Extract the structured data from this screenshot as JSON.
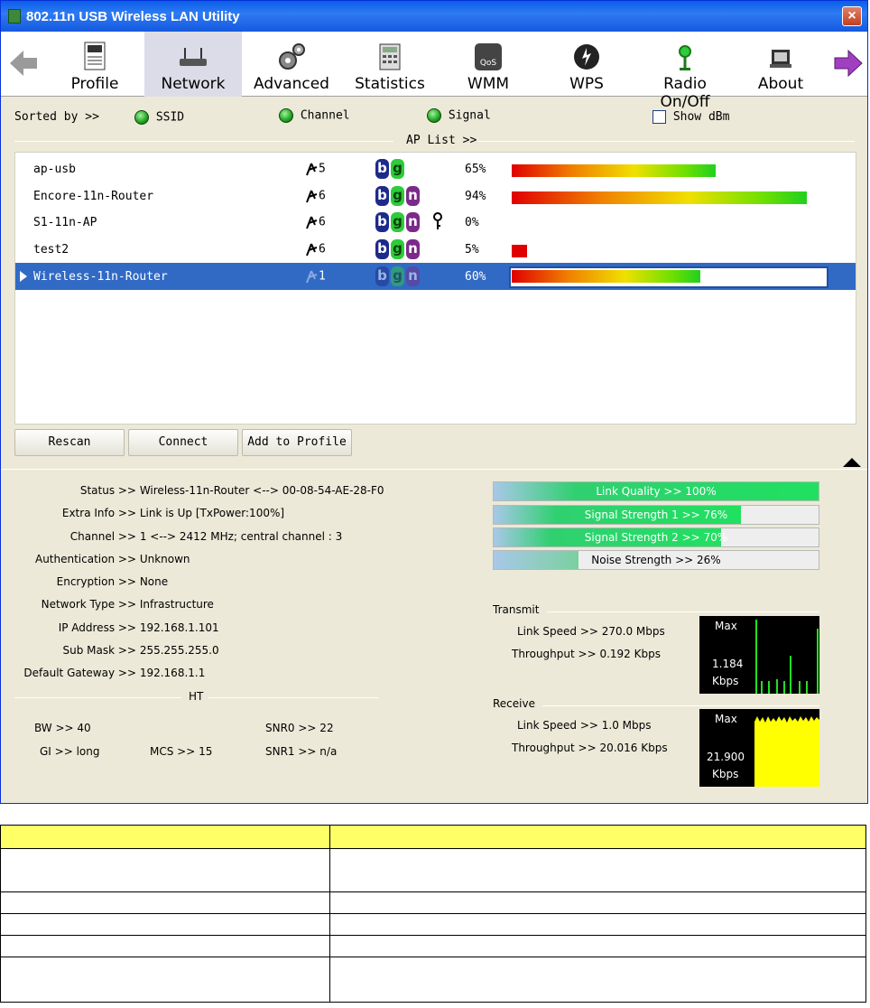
{
  "window": {
    "title": "802.11n USB Wireless LAN Utility",
    "close": "×"
  },
  "toolbar": {
    "items": [
      {
        "label": "Profile",
        "icon": "profile-icon"
      },
      {
        "label": "Network",
        "icon": "router-icon"
      },
      {
        "label": "Advanced",
        "icon": "gears-icon"
      },
      {
        "label": "Statistics",
        "icon": "calculator-icon"
      },
      {
        "label": "WMM",
        "icon": "qos-icon"
      },
      {
        "label": "WPS",
        "icon": "wps-icon"
      },
      {
        "label": "Radio On/Off",
        "icon": "radio-icon"
      },
      {
        "label": "About",
        "icon": "about-icon"
      }
    ]
  },
  "sort": {
    "label": "Sorted by >>",
    "ssid": "SSID",
    "channel": "Channel",
    "signal": "Signal",
    "show_dbm": "Show dBm"
  },
  "ap_list": {
    "title": "AP List >>",
    "rows": [
      {
        "ssid": "ap-usb",
        "channel": "5",
        "modes": [
          "b",
          "g"
        ],
        "signal": "65%",
        "signal_value": 65,
        "locked": false
      },
      {
        "ssid": "Encore-11n-Router",
        "channel": "6",
        "modes": [
          "b",
          "g",
          "n"
        ],
        "signal": "94%",
        "signal_value": 94,
        "locked": false
      },
      {
        "ssid": "S1-11n-AP",
        "channel": "6",
        "modes": [
          "b",
          "g",
          "n"
        ],
        "signal": "0%",
        "signal_value": 0,
        "locked": true
      },
      {
        "ssid": "test2",
        "channel": "6",
        "modes": [
          "b",
          "g",
          "n"
        ],
        "signal": "5%",
        "signal_value": 5,
        "locked": false
      },
      {
        "ssid": "Wireless-11n-Router",
        "channel": "1",
        "modes": [
          "b",
          "g",
          "n"
        ],
        "signal": "60%",
        "signal_value": 60,
        "locked": false,
        "selected": true
      }
    ]
  },
  "buttons": {
    "rescan": "Rescan",
    "connect": "Connect",
    "add_profile": "Add to Profile"
  },
  "status": {
    "status_k": "Status >>",
    "status_v": "Wireless-11n-Router <--> 00-08-54-AE-28-F0",
    "extra_k": "Extra Info >>",
    "extra_v": "Link is Up [TxPower:100%]",
    "channel_k": "Channel >>",
    "channel_v": "1 <--> 2412 MHz; central channel : 3",
    "auth_k": "Authentication >>",
    "auth_v": "Unknown",
    "enc_k": "Encryption >>",
    "enc_v": "None",
    "nettype_k": "Network Type >>",
    "nettype_v": "Infrastructure",
    "ip_k": "IP Address >>",
    "ip_v": "192.168.1.101",
    "mask_k": "Sub Mask >>",
    "mask_v": "255.255.255.0",
    "gw_k": "Default Gateway >>",
    "gw_v": "192.168.1.1"
  },
  "ht": {
    "title": "HT",
    "bw": "BW >> 40",
    "gi": "GI >> long",
    "mcs": "MCS >> 15",
    "snr0": "SNR0 >> 22",
    "snr1": "SNR1 >> n/a"
  },
  "meters": [
    {
      "label": "Link Quality >> 100%",
      "value": 100
    },
    {
      "label": "Signal Strength 1 >> 76%",
      "value": 76
    },
    {
      "label": "Signal Strength 2 >> 70%",
      "value": 70
    },
    {
      "label": "Noise Strength >> 26%",
      "value": 26
    }
  ],
  "transmit": {
    "title": "Transmit",
    "link_speed": "Link Speed >> 270.0 Mbps",
    "throughput": "Throughput >> 0.192 Kbps",
    "graph_max": "Max",
    "graph_value": "1.184",
    "graph_unit": "Kbps"
  },
  "receive": {
    "title": "Receive",
    "link_speed": "Link Speed >> 1.0 Mbps",
    "throughput": "Throughput >> 20.016 Kbps",
    "graph_max": "Max",
    "graph_value": "21.900",
    "graph_unit": "Kbps"
  },
  "colors": {
    "accent": "#316AC5",
    "title_bar": "#0A5EE8",
    "table_header": "#FFFF66"
  }
}
